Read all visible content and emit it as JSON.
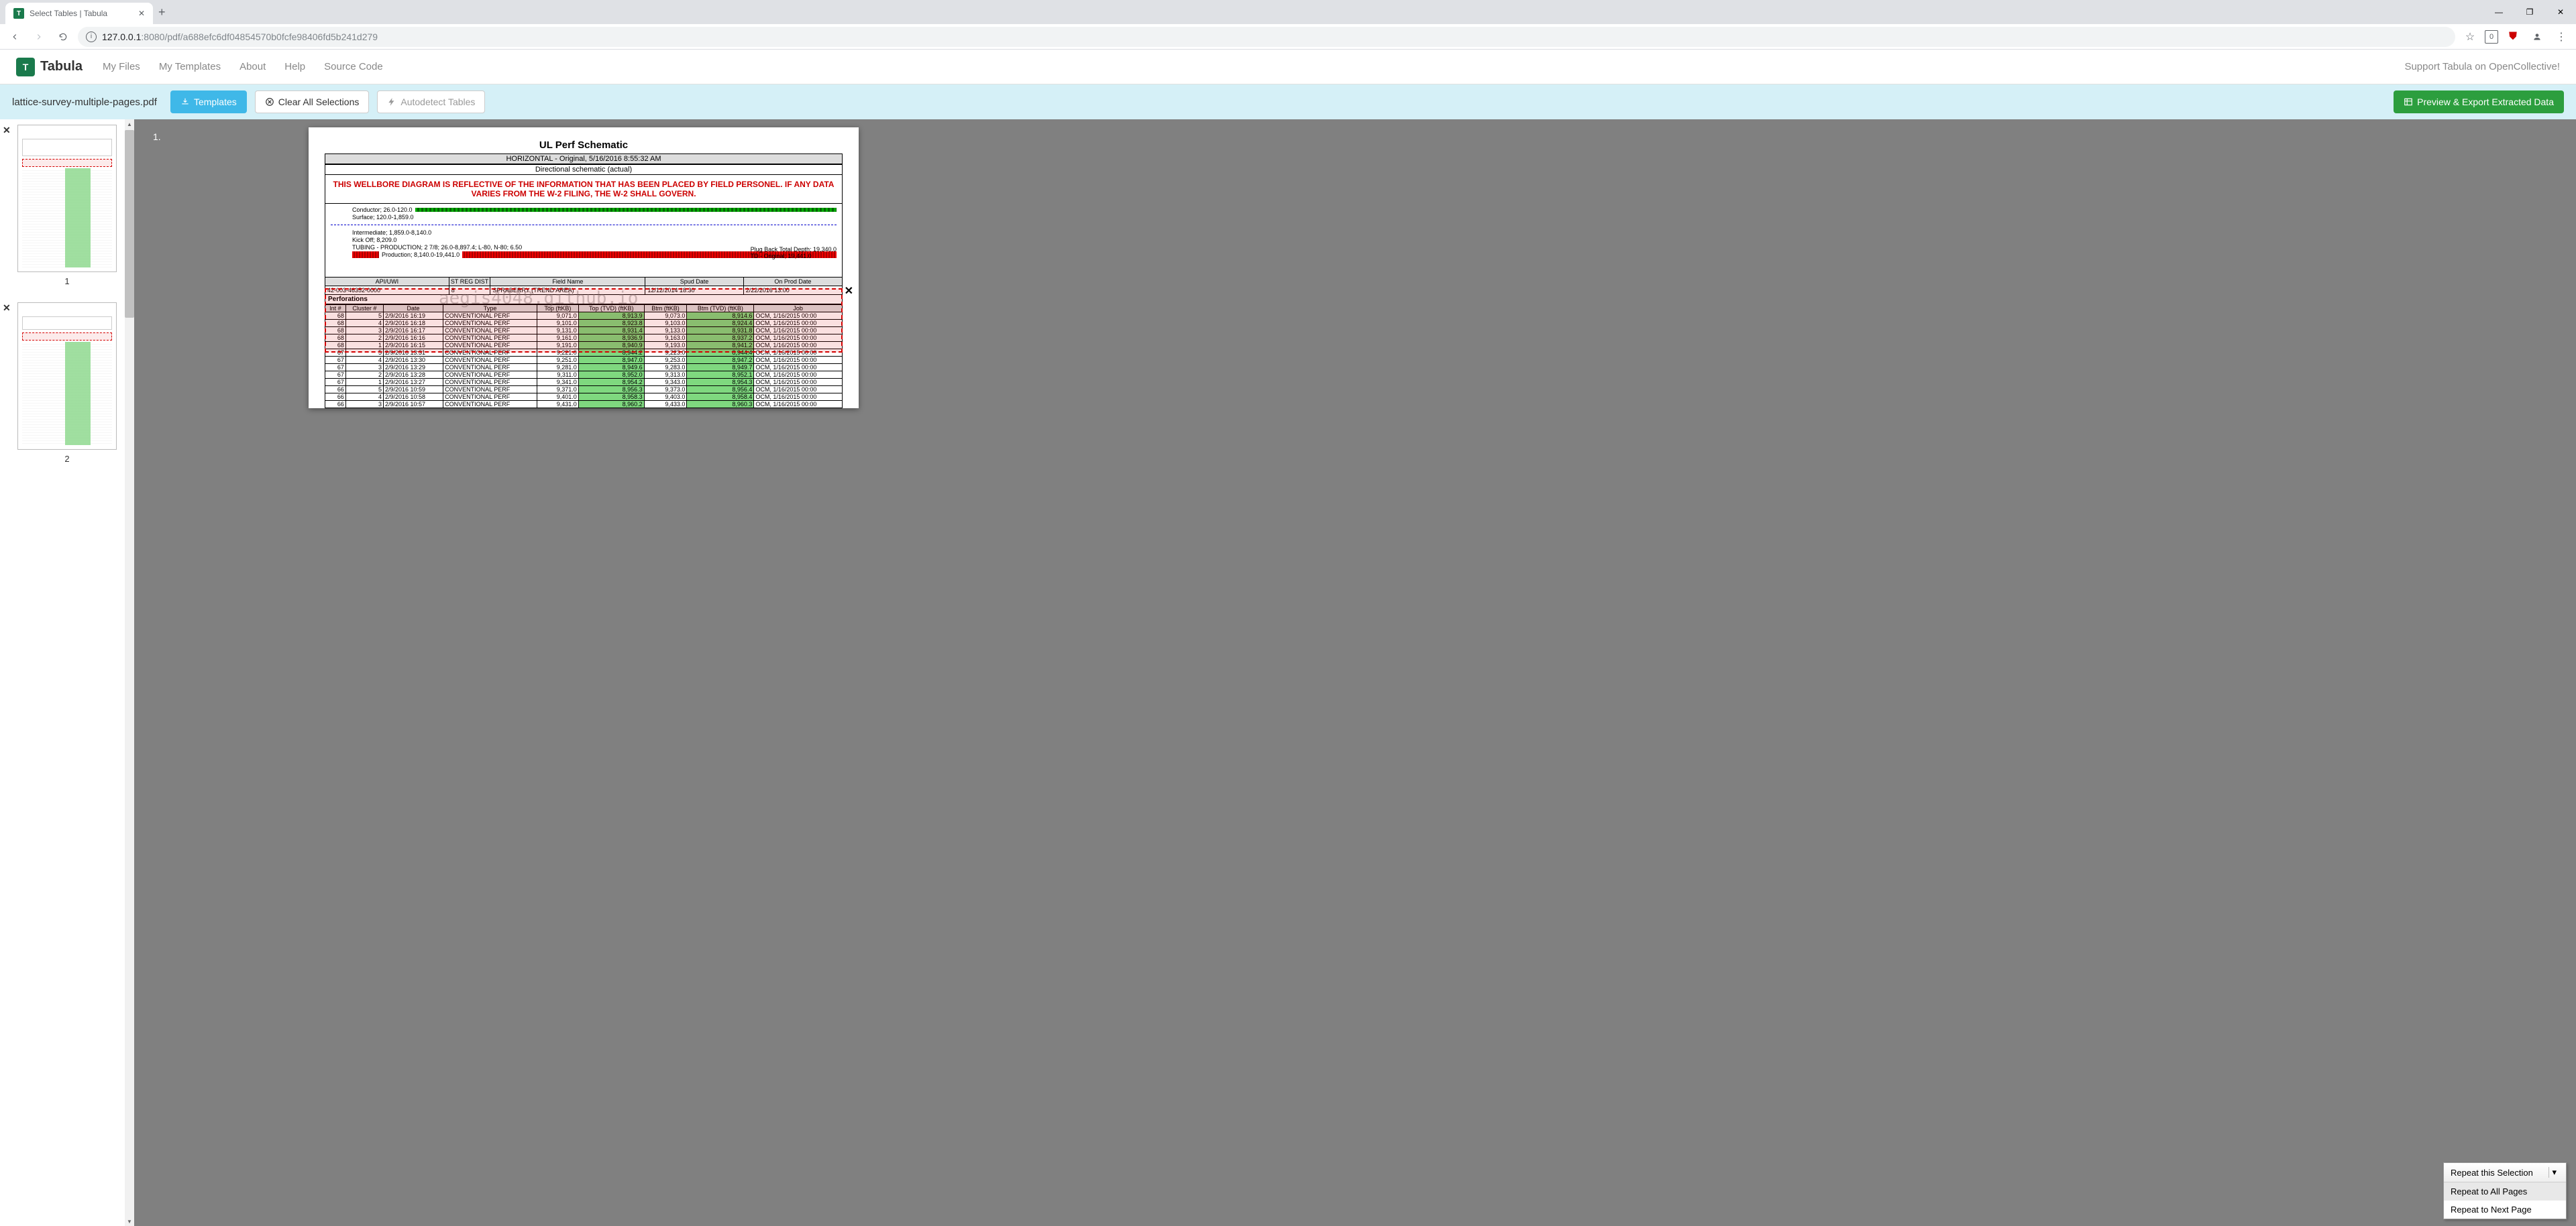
{
  "browser": {
    "tab_title": "Select Tables | Tabula",
    "url_host": "127.0.0.1",
    "url_port": ":8080",
    "url_path": "/pdf/a688efc6df04854570b0fcfe98406fd5b241d279"
  },
  "app": {
    "brand": "Tabula",
    "nav": {
      "my_files": "My Files",
      "my_templates": "My Templates",
      "about": "About",
      "help": "Help",
      "source_code": "Source Code"
    },
    "support": "Support Tabula on OpenCollective!"
  },
  "toolbar": {
    "filename": "lattice-survey-multiple-pages.pdf",
    "templates": "Templates",
    "clear": "Clear All Selections",
    "autodetect": "Autodetect Tables",
    "export": "Preview & Export Extracted Data"
  },
  "thumbs": {
    "p1": "1",
    "p2": "2"
  },
  "page": {
    "num_label": "1.",
    "title": "UL Perf Schematic",
    "meta1": "HORIZONTAL - Original, 5/16/2016 8:55:32 AM",
    "meta2": "Directional schematic (actual)",
    "notice": "THIS WELLBORE DIAGRAM IS REFLECTIVE OF THE INFORMATION THAT HAS BEEN PLACED BY FIELD PERSONEL.  IF ANY DATA VARIES FROM THE W-2 FILING, THE W-2 SHALL GOVERN.",
    "schem": {
      "conductor": "Conductor; 26.0-120.0",
      "surface": "Surface; 120.0-1,859.0",
      "intermediate": "Intermediate; 1,859.0-8,140.0",
      "kickoff": "Kick Off; 8,209.0",
      "tubing": "TUBING - PRODUCTION; 2 7/8; 26.0-8,897.4; L-80, N-80; 6.50",
      "production": "Production; 8,140.0-19,441.0",
      "plug": "Plug Back Total Depth; 19,340.0",
      "td": "TD - Original; 19,441.0"
    },
    "hdr": {
      "api_label": "API/UWI",
      "api_val": "42-003-46352-0000",
      "reg_label": "ST REG DIST",
      "reg_val": "8",
      "field_label": "Field Name",
      "field_val": "SPRABERRY (TREND AREA)",
      "spud_label": "Spud Date",
      "spud_val": "12/12/2014 18:30",
      "prod_label": "On Prod Date",
      "prod_val": "2/22/2016 13:00"
    },
    "perfs_label": "Perforations",
    "watermark": "aegis4048.github.io",
    "cols": {
      "int": "Int #",
      "cluster": "Cluster #",
      "date": "Date",
      "type": "Type",
      "top_ftkb": "Top (ftKB)",
      "top_tvd": "Top (TVD) (ftKB)",
      "btm_ftkb": "Btm (ftKB)",
      "btm_tvd": "Btm (TVD) (ftKB)",
      "job": "Job"
    },
    "rows": [
      {
        "int": "68",
        "cl": "5",
        "date": "2/9/2016 16:19",
        "type": "CONVENTIONAL PERF",
        "top": "9,071.0",
        "toptvd": "8,913.9",
        "btm": "9,073.0",
        "btmtvd": "8,914.6",
        "job": "OCM, 1/16/2015 00:00"
      },
      {
        "int": "68",
        "cl": "4",
        "date": "2/9/2016 16:18",
        "type": "CONVENTIONAL PERF",
        "top": "9,101.0",
        "toptvd": "8,923.8",
        "btm": "9,103.0",
        "btmtvd": "8,924.4",
        "job": "OCM, 1/16/2015 00:00"
      },
      {
        "int": "68",
        "cl": "3",
        "date": "2/9/2016 16:17",
        "type": "CONVENTIONAL PERF",
        "top": "9,131.0",
        "toptvd": "8,931.4",
        "btm": "9,133.0",
        "btmtvd": "8,931.8",
        "job": "OCM, 1/16/2015 00:00"
      },
      {
        "int": "68",
        "cl": "2",
        "date": "2/9/2016 16:16",
        "type": "CONVENTIONAL PERF",
        "top": "9,161.0",
        "toptvd": "8,936.9",
        "btm": "9,163.0",
        "btmtvd": "8,937.2",
        "job": "OCM, 1/16/2015 00:00"
      },
      {
        "int": "68",
        "cl": "1",
        "date": "2/9/2016 16:15",
        "type": "CONVENTIONAL PERF",
        "top": "9,191.0",
        "toptvd": "8,940.9",
        "btm": "9,193.0",
        "btmtvd": "8,941.2",
        "job": "OCM, 1/16/2015 00:00"
      },
      {
        "int": "67",
        "cl": "5",
        "date": "2/9/2016 13:31",
        "type": "CONVENTIONAL PERF",
        "top": "9,221.0",
        "toptvd": "8,944.2",
        "btm": "9,223.0",
        "btmtvd": "8,944.4",
        "job": "OCM, 1/16/2015 00:00"
      },
      {
        "int": "67",
        "cl": "4",
        "date": "2/9/2016 13:30",
        "type": "CONVENTIONAL PERF",
        "top": "9,251.0",
        "toptvd": "8,947.0",
        "btm": "9,253.0",
        "btmtvd": "8,947.2",
        "job": "OCM, 1/16/2015 00:00"
      },
      {
        "int": "67",
        "cl": "3",
        "date": "2/9/2016 13:29",
        "type": "CONVENTIONAL PERF",
        "top": "9,281.0",
        "toptvd": "8,949.6",
        "btm": "9,283.0",
        "btmtvd": "8,949.7",
        "job": "OCM, 1/16/2015 00:00"
      },
      {
        "int": "67",
        "cl": "2",
        "date": "2/9/2016 13:28",
        "type": "CONVENTIONAL PERF",
        "top": "9,311.0",
        "toptvd": "8,952.0",
        "btm": "9,313.0",
        "btmtvd": "8,952.1",
        "job": "OCM, 1/16/2015 00:00"
      },
      {
        "int": "67",
        "cl": "1",
        "date": "2/9/2016 13:27",
        "type": "CONVENTIONAL PERF",
        "top": "9,341.0",
        "toptvd": "8,954.2",
        "btm": "9,343.0",
        "btmtvd": "8,954.3",
        "job": "OCM, 1/16/2015 00:00"
      },
      {
        "int": "66",
        "cl": "5",
        "date": "2/9/2016 10:59",
        "type": "CONVENTIONAL PERF",
        "top": "9,371.0",
        "toptvd": "8,956.3",
        "btm": "9,373.0",
        "btmtvd": "8,956.4",
        "job": "OCM, 1/16/2015 00:00"
      },
      {
        "int": "66",
        "cl": "4",
        "date": "2/9/2016 10:58",
        "type": "CONVENTIONAL PERF",
        "top": "9,401.0",
        "toptvd": "8,958.3",
        "btm": "9,403.0",
        "btmtvd": "8,958.4",
        "job": "OCM, 1/16/2015 00:00"
      },
      {
        "int": "66",
        "cl": "3",
        "date": "2/9/2016 10:57",
        "type": "CONVENTIONAL PERF",
        "top": "9,431.0",
        "toptvd": "8,960.2",
        "btm": "9,433.0",
        "btmtvd": "8,960.3",
        "job": "OCM, 1/16/2015 00:00"
      }
    ]
  },
  "dropdown": {
    "main": "Repeat this Selection",
    "all": "Repeat to All Pages",
    "next": "Repeat to Next Page"
  }
}
